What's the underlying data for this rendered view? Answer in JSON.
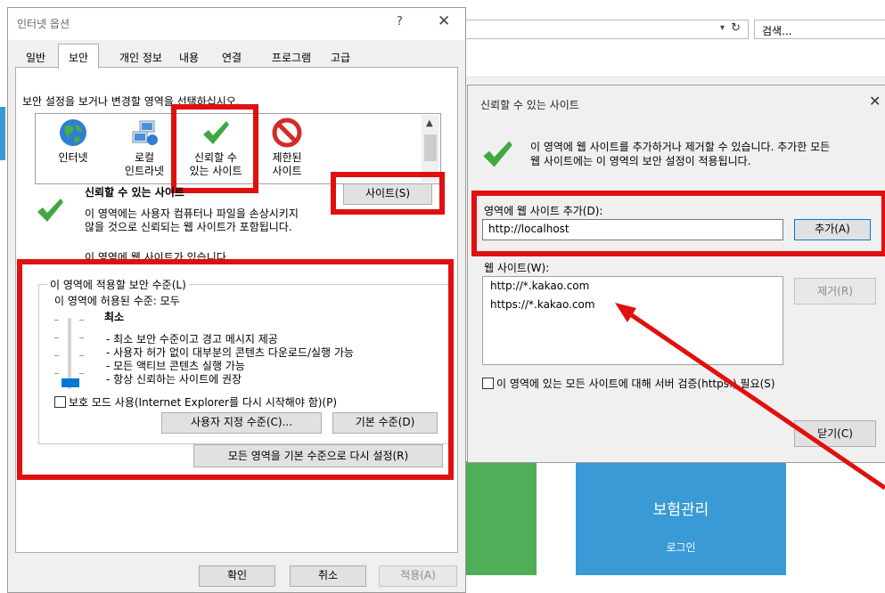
{
  "browser": {
    "search_placeholder": "검색...",
    "tile_title": "보험관리",
    "tile_subtitle": "로그인"
  },
  "internet_options": {
    "title": "인터넷 옵션",
    "help_glyph": "?",
    "close_glyph": "✕",
    "tabs": [
      "일반",
      "보안",
      "개인 정보",
      "내용",
      "연결",
      "프로그램",
      "고급"
    ],
    "active_tab": "보안",
    "instruction": "보안 설정을 보거나 변경할 영역을 선택하십시오.",
    "zones": [
      {
        "label1": "인터넷",
        "label2": "",
        "icon": "globe-icon"
      },
      {
        "label1": "로컬",
        "label2": "인트라넷",
        "icon": "network-icon"
      },
      {
        "label1": "신뢰할 수",
        "label2": "있는 사이트",
        "icon": "checkmark-icon"
      },
      {
        "label1": "제한된",
        "label2": "사이트",
        "icon": "restricted-icon"
      }
    ],
    "zone_heading": "신뢰할 수 있는 사이트",
    "zone_desc_1": "이 영역에는 사용자 컴퓨터나 파일을 손상시키지",
    "zone_desc_2": "않을 것으로 신뢰되는 웹 사이트가 포함됩니다.",
    "zone_note": "이 영역에 웹 사이트가 있습니다.",
    "sites_button": "사이트(S)",
    "security_group_label": "이 영역에 적용할 보안 수준(L)",
    "allowed_level": "이 영역에 허용된 수준: 모두",
    "level_name": "최소",
    "level_bullets": [
      "- 최소 보안 수준이고 경고 메시지 제공",
      "- 사용자 허가 없이 대부분의 콘텐츠 다운로드/실행 가능",
      "- 모든 액티브 콘텐츠 실행 가능",
      "- 항상 신뢰하는 사이트에 권장"
    ],
    "slider_level": 0,
    "protected_mode_label": "보호 모드 사용(Internet Explorer를 다시 시작해야 함)(P)",
    "protected_mode_checked": false,
    "custom_level_button": "사용자 지정 수준(C)...",
    "default_level_button": "기본 수준(D)",
    "reset_all_button": "모든 영역을 기본 수준으로 다시 설정(R)",
    "ok_button": "확인",
    "cancel_button": "취소",
    "apply_button": "적용(A)"
  },
  "trusted_sites": {
    "title": "신뢰할 수 있는 사이트",
    "close_glyph": "✕",
    "description_1": "이 영역에 웹 사이트를 추가하거나 제거할 수 있습니다. 추가한 모든",
    "description_2": "웹 사이트에는 이 영역의 보안 설정이 적용됩니다.",
    "add_label": "영역에 웹 사이트 추가(D):",
    "add_value": "http://localhost",
    "add_button": "추가(A)",
    "websites_label": "웹 사이트(W):",
    "websites": [
      "http://*.kakao.com",
      "https://*.kakao.com"
    ],
    "remove_button": "제거(R)",
    "https_label": "이 영역에 있는 모든 사이트에 대해 서버 검증(https:) 필요(S)",
    "https_checked": false,
    "close_button": "닫기(C)"
  },
  "colors": {
    "highlight_red": "#e01010",
    "check_green": "#3fa83f",
    "tile_blue": "#3a9ad5",
    "tile_green": "#4fae57",
    "slider_blue": "#0078d7"
  }
}
